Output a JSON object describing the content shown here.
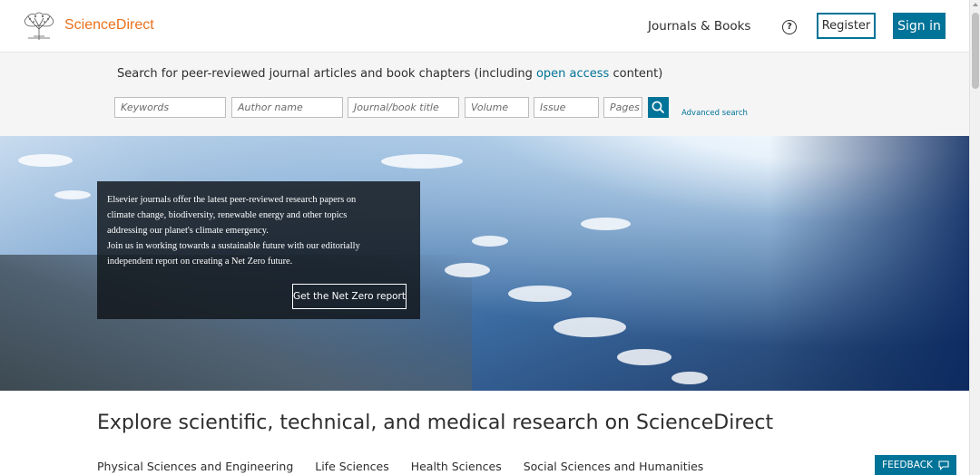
{
  "header": {
    "brand": "ScienceDirect",
    "nav_journals": "Journals & Books",
    "help_symbol": "?",
    "register_label": "Register",
    "signin_label": "Sign in"
  },
  "search": {
    "intro_prefix": "Search for peer-reviewed journal articles and book chapters (including ",
    "intro_link": "open access",
    "intro_suffix": " content)",
    "keywords_placeholder": "Keywords",
    "author_placeholder": "Author name",
    "journal_placeholder": "Journal/book title",
    "volume_placeholder": "Volume",
    "issue_placeholder": "Issue",
    "pages_placeholder": "Pages",
    "advanced_label": "Advanced search"
  },
  "hero": {
    "line1": "Elsevier journals offer the latest peer-reviewed research papers on",
    "line2": "climate change, biodiversity, renewable energy and other topics",
    "line3": "addressing our planet's climate emergency.",
    "line4": "Join us in working towards a sustainable future with our editorially",
    "line5": "independent report on creating a Net Zero future.",
    "button_label": "Get the Net Zero report"
  },
  "explore": {
    "title": "Explore scientific, technical, and medical research on ScienceDirect",
    "categories": [
      "Physical Sciences and Engineering",
      "Life Sciences",
      "Health Sciences",
      "Social Sciences and Humanities"
    ]
  },
  "feedback_label": "FEEDBACK",
  "colors": {
    "brand": "#e9711c",
    "accent": "#007398"
  }
}
